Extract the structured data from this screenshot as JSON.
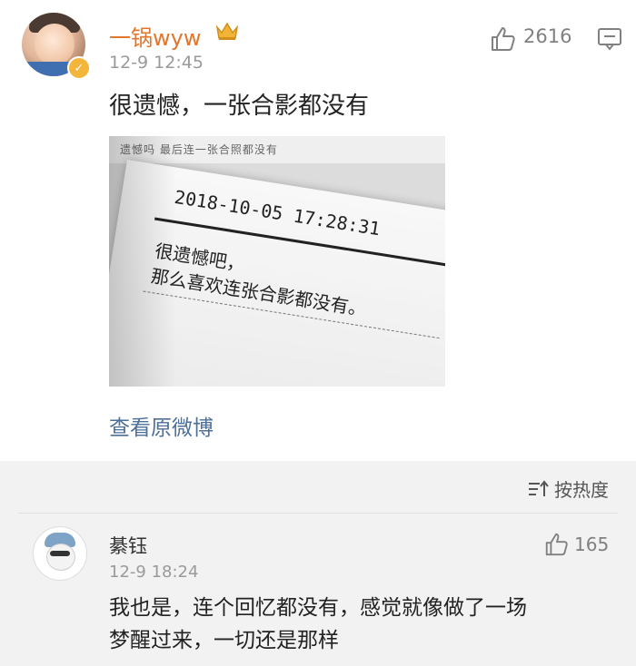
{
  "post": {
    "username": "一锅wyw",
    "time": "12-9 12:45",
    "like_count": "2616",
    "text": "很遗憾，一张合影都没有",
    "image": {
      "top_caption": "遗憾吗 最后连一张合照都没有",
      "date": "2018-10-05 17:28:31",
      "message_line1": "很遗憾吧，",
      "message_line2": "那么喜欢连张合影都没有。"
    },
    "view_original_label": "查看原微博"
  },
  "comments_header": {
    "sort_label": "按热度"
  },
  "comment": {
    "username": "綦钰",
    "time": "12-9 18:24",
    "like_count": "165",
    "text_line1": "我也是，连个回忆都没有，感觉就像做了一场",
    "text_line2": "梦醒过来，一切还是那样"
  },
  "colors": {
    "username": "#e2762d",
    "link": "#4d6f99",
    "meta": "#9a9a9a",
    "verify_badge": "#f3b63a"
  },
  "icons": {
    "like": "thumbs-up-icon",
    "comment": "comment-icon",
    "sort": "sort-icon",
    "crown": "crown-icon",
    "verified": "verified-badge-icon"
  }
}
